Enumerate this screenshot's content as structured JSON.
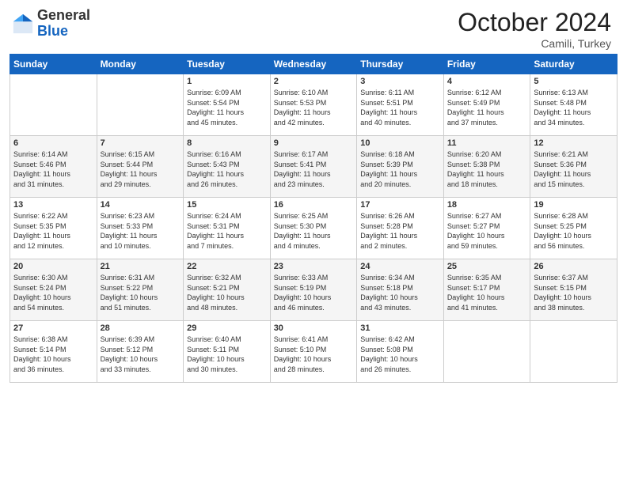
{
  "header": {
    "logo": {
      "general": "General",
      "blue": "Blue"
    },
    "title": "October 2024",
    "location": "Camili, Turkey"
  },
  "weekdays": [
    "Sunday",
    "Monday",
    "Tuesday",
    "Wednesday",
    "Thursday",
    "Friday",
    "Saturday"
  ],
  "weeks": [
    [
      {
        "day": "",
        "info": ""
      },
      {
        "day": "",
        "info": ""
      },
      {
        "day": "1",
        "info": "Sunrise: 6:09 AM\nSunset: 5:54 PM\nDaylight: 11 hours\nand 45 minutes."
      },
      {
        "day": "2",
        "info": "Sunrise: 6:10 AM\nSunset: 5:53 PM\nDaylight: 11 hours\nand 42 minutes."
      },
      {
        "day": "3",
        "info": "Sunrise: 6:11 AM\nSunset: 5:51 PM\nDaylight: 11 hours\nand 40 minutes."
      },
      {
        "day": "4",
        "info": "Sunrise: 6:12 AM\nSunset: 5:49 PM\nDaylight: 11 hours\nand 37 minutes."
      },
      {
        "day": "5",
        "info": "Sunrise: 6:13 AM\nSunset: 5:48 PM\nDaylight: 11 hours\nand 34 minutes."
      }
    ],
    [
      {
        "day": "6",
        "info": "Sunrise: 6:14 AM\nSunset: 5:46 PM\nDaylight: 11 hours\nand 31 minutes."
      },
      {
        "day": "7",
        "info": "Sunrise: 6:15 AM\nSunset: 5:44 PM\nDaylight: 11 hours\nand 29 minutes."
      },
      {
        "day": "8",
        "info": "Sunrise: 6:16 AM\nSunset: 5:43 PM\nDaylight: 11 hours\nand 26 minutes."
      },
      {
        "day": "9",
        "info": "Sunrise: 6:17 AM\nSunset: 5:41 PM\nDaylight: 11 hours\nand 23 minutes."
      },
      {
        "day": "10",
        "info": "Sunrise: 6:18 AM\nSunset: 5:39 PM\nDaylight: 11 hours\nand 20 minutes."
      },
      {
        "day": "11",
        "info": "Sunrise: 6:20 AM\nSunset: 5:38 PM\nDaylight: 11 hours\nand 18 minutes."
      },
      {
        "day": "12",
        "info": "Sunrise: 6:21 AM\nSunset: 5:36 PM\nDaylight: 11 hours\nand 15 minutes."
      }
    ],
    [
      {
        "day": "13",
        "info": "Sunrise: 6:22 AM\nSunset: 5:35 PM\nDaylight: 11 hours\nand 12 minutes."
      },
      {
        "day": "14",
        "info": "Sunrise: 6:23 AM\nSunset: 5:33 PM\nDaylight: 11 hours\nand 10 minutes."
      },
      {
        "day": "15",
        "info": "Sunrise: 6:24 AM\nSunset: 5:31 PM\nDaylight: 11 hours\nand 7 minutes."
      },
      {
        "day": "16",
        "info": "Sunrise: 6:25 AM\nSunset: 5:30 PM\nDaylight: 11 hours\nand 4 minutes."
      },
      {
        "day": "17",
        "info": "Sunrise: 6:26 AM\nSunset: 5:28 PM\nDaylight: 11 hours\nand 2 minutes."
      },
      {
        "day": "18",
        "info": "Sunrise: 6:27 AM\nSunset: 5:27 PM\nDaylight: 10 hours\nand 59 minutes."
      },
      {
        "day": "19",
        "info": "Sunrise: 6:28 AM\nSunset: 5:25 PM\nDaylight: 10 hours\nand 56 minutes."
      }
    ],
    [
      {
        "day": "20",
        "info": "Sunrise: 6:30 AM\nSunset: 5:24 PM\nDaylight: 10 hours\nand 54 minutes."
      },
      {
        "day": "21",
        "info": "Sunrise: 6:31 AM\nSunset: 5:22 PM\nDaylight: 10 hours\nand 51 minutes."
      },
      {
        "day": "22",
        "info": "Sunrise: 6:32 AM\nSunset: 5:21 PM\nDaylight: 10 hours\nand 48 minutes."
      },
      {
        "day": "23",
        "info": "Sunrise: 6:33 AM\nSunset: 5:19 PM\nDaylight: 10 hours\nand 46 minutes."
      },
      {
        "day": "24",
        "info": "Sunrise: 6:34 AM\nSunset: 5:18 PM\nDaylight: 10 hours\nand 43 minutes."
      },
      {
        "day": "25",
        "info": "Sunrise: 6:35 AM\nSunset: 5:17 PM\nDaylight: 10 hours\nand 41 minutes."
      },
      {
        "day": "26",
        "info": "Sunrise: 6:37 AM\nSunset: 5:15 PM\nDaylight: 10 hours\nand 38 minutes."
      }
    ],
    [
      {
        "day": "27",
        "info": "Sunrise: 6:38 AM\nSunset: 5:14 PM\nDaylight: 10 hours\nand 36 minutes."
      },
      {
        "day": "28",
        "info": "Sunrise: 6:39 AM\nSunset: 5:12 PM\nDaylight: 10 hours\nand 33 minutes."
      },
      {
        "day": "29",
        "info": "Sunrise: 6:40 AM\nSunset: 5:11 PM\nDaylight: 10 hours\nand 30 minutes."
      },
      {
        "day": "30",
        "info": "Sunrise: 6:41 AM\nSunset: 5:10 PM\nDaylight: 10 hours\nand 28 minutes."
      },
      {
        "day": "31",
        "info": "Sunrise: 6:42 AM\nSunset: 5:08 PM\nDaylight: 10 hours\nand 26 minutes."
      },
      {
        "day": "",
        "info": ""
      },
      {
        "day": "",
        "info": ""
      }
    ]
  ]
}
